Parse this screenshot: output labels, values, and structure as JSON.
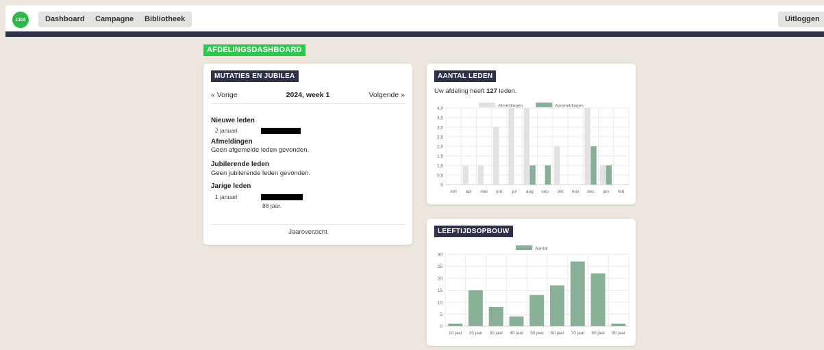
{
  "nav": {
    "logo_text": "CDA",
    "items": [
      {
        "label": "Dashboard"
      },
      {
        "label": "Campagne"
      },
      {
        "label": "Bibliotheek"
      }
    ],
    "logout_label": "Uitloggen"
  },
  "page": {
    "section_label": "AFDELINGSDASHBOARD"
  },
  "mutaties": {
    "title": "MUTATIES EN JUBILEA",
    "prev_label": "« Vorige",
    "week_label": "2024, week 1",
    "next_label": "Volgende »",
    "nieuwe_leden": {
      "title": "Nieuwe leden",
      "date": "2 januari"
    },
    "afmeldingen": {
      "title": "Afmeldingen",
      "text": "Geen afgemelde leden gevonden."
    },
    "jubilerende": {
      "title": "Jubilerende leden",
      "text": "Geen jubilerende leden gevonden."
    },
    "jarige": {
      "title": "Jarige leden",
      "date": "1 januari",
      "age": "88 jaar."
    },
    "footer_link": "Jaaroverzicht"
  },
  "aantal_leden": {
    "title": "AANTAL LEDEN",
    "text_prefix": "Uw afdeling heeft ",
    "count": "127",
    "text_suffix": " leden."
  },
  "leeftijd": {
    "title": "LEEFTIJDSOPBOUW"
  },
  "chart_data": [
    {
      "type": "bar",
      "categories": [
        "mrt",
        "apr",
        "mei",
        "jun",
        "jul",
        "aug",
        "sep",
        "okt",
        "nov",
        "dec",
        "jan",
        "feb"
      ],
      "series": [
        {
          "name": "Afmeldingen",
          "color": "#e2e2e2",
          "values": [
            0,
            1,
            1,
            3,
            4,
            4,
            0,
            2,
            0,
            4,
            1,
            0
          ]
        },
        {
          "name": "Aanmeldingen",
          "color": "#88b096",
          "values": [
            0,
            0,
            0,
            0,
            0,
            1,
            1,
            0,
            0,
            2,
            1,
            0
          ]
        }
      ],
      "ylim": [
        0,
        4
      ],
      "yticks": [
        "0",
        "0,5",
        "1,0",
        "1,5",
        "2,0",
        "2,5",
        "3,0",
        "3,5",
        "4,0"
      ],
      "legend": "top",
      "grid": true
    },
    {
      "type": "bar",
      "categories": [
        "10 jaar",
        "20 jaar",
        "30 jaar",
        "40 jaar",
        "50 jaar",
        "60 jaar",
        "70 jaar",
        "80 jaar",
        "90 jaar"
      ],
      "series": [
        {
          "name": "Aantal",
          "color": "#88b096",
          "values": [
            1,
            15,
            8,
            4,
            13,
            17,
            27,
            22,
            1
          ]
        }
      ],
      "ylim": [
        0,
        30
      ],
      "yticks": [
        "0",
        "5",
        "10",
        "15",
        "20",
        "25",
        "30"
      ],
      "legend": "top",
      "grid": true
    }
  ]
}
